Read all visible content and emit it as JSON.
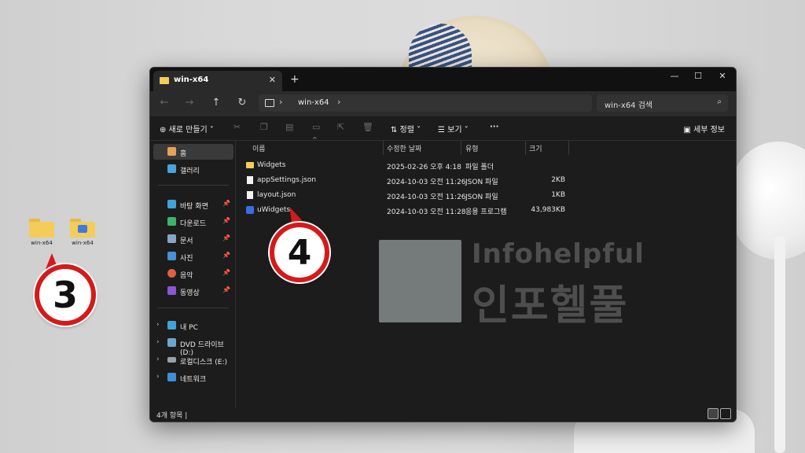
{
  "desktop": {
    "icons": [
      {
        "label": "win-x64"
      },
      {
        "label": "win-x64"
      }
    ],
    "callout_3": "3",
    "callout_4": "4"
  },
  "watermark": {
    "en": "Infohelpful",
    "ko": "인포헬풀"
  },
  "window": {
    "tab_title": "win-x64",
    "tab_close": "✕",
    "new_tab": "+",
    "controls": {
      "minimize": "—",
      "maximize": "☐",
      "close": "✕"
    },
    "nav": {
      "back": "←",
      "forward": "→",
      "up": "↑",
      "refresh": "↻"
    },
    "address": {
      "separator": "›",
      "crumb": "win-x64"
    },
    "search": {
      "placeholder": "win-x64 검색",
      "icon": "search-icon"
    },
    "toolbar": {
      "new_label": "⊕ 새로 만들기 ˅",
      "icons": [
        "cut-icon",
        "copy-icon",
        "paste-icon",
        "rename-icon",
        "share-icon",
        "delete-icon"
      ],
      "sort_label": "⇅ 정렬 ˅",
      "view_label": "☰ 보기 ˅",
      "more": "···",
      "details_label": "세부 정보"
    },
    "sidebar": {
      "items": [
        {
          "label": "홈",
          "icon": "home-icon",
          "color": "#e8a15a",
          "selected": true
        },
        {
          "label": "갤러리",
          "icon": "gallery-icon",
          "color": "#4aa3e0"
        },
        {
          "label": "바탕 화면",
          "icon": "desktop-icon",
          "color": "#3fa3d8",
          "pinned": true
        },
        {
          "label": "다운로드",
          "icon": "download-icon",
          "color": "#3fb36b",
          "pinned": true
        },
        {
          "label": "문서",
          "icon": "documents-icon",
          "color": "#8aa4c8",
          "pinned": true
        },
        {
          "label": "사진",
          "icon": "pictures-icon",
          "color": "#4a8fd8",
          "pinned": true
        },
        {
          "label": "음악",
          "icon": "music-icon",
          "color": "#e06040",
          "pinned": true
        },
        {
          "label": "동영상",
          "icon": "videos-icon",
          "color": "#8b55d6",
          "pinned": true
        },
        {
          "label": "내 PC",
          "icon": "pc-icon",
          "color": "#3fa3d8",
          "expandable": true
        },
        {
          "label": "DVD 드라이브 (D:)",
          "icon": "dvd-drive-icon",
          "color": "#6aa8c8",
          "expandable": true
        },
        {
          "label": "로컬디스크 (E:)",
          "icon": "disk-icon",
          "color": "#9aa0a8",
          "expandable": true
        },
        {
          "label": "네트워크",
          "icon": "network-icon",
          "color": "#3f8fd8",
          "expandable": true
        }
      ]
    },
    "columns": {
      "name": "이름",
      "date": "수정한 날짜",
      "type": "유형",
      "size": "크기"
    },
    "files": [
      {
        "name": "Widgets",
        "date": "2025-02-26 오후 4:18",
        "type": "파일 폴더",
        "size": "",
        "icon": "folder-icon"
      },
      {
        "name": "appSettings.json",
        "date": "2024-10-03 오전 11:26",
        "type": "JSON 파일",
        "size": "2KB",
        "icon": "file-icon"
      },
      {
        "name": "layout.json",
        "date": "2024-10-03 오전 11:26",
        "type": "JSON 파일",
        "size": "1KB",
        "icon": "file-icon"
      },
      {
        "name": "uWidgets",
        "date": "2024-10-03 오전 11:28",
        "type": "응용 프로그램",
        "size": "43,983KB",
        "icon": "app-icon"
      }
    ],
    "status": {
      "count": "4개 항목 |"
    }
  }
}
